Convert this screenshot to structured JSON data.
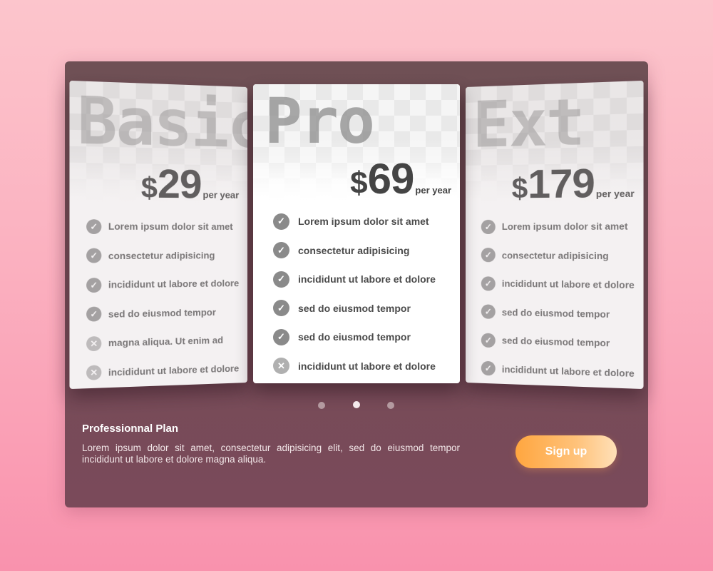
{
  "plans": [
    {
      "name": "Basic",
      "currency": "$",
      "amount": "29",
      "period": "per year",
      "features": [
        {
          "text": "Lorem ipsum dolor sit amet",
          "included": true
        },
        {
          "text": "consectetur adipisicing",
          "included": true
        },
        {
          "text": "incididunt ut labore et dolore",
          "included": true
        },
        {
          "text": "sed do eiusmod tempor",
          "included": true
        },
        {
          "text": "magna aliqua. Ut enim ad",
          "included": false
        },
        {
          "text": "incididunt ut labore et dolore",
          "included": false
        }
      ]
    },
    {
      "name": "Pro",
      "currency": "$",
      "amount": "69",
      "period": "per year",
      "features": [
        {
          "text": "Lorem ipsum dolor sit amet",
          "included": true
        },
        {
          "text": "consectetur adipisicing",
          "included": true
        },
        {
          "text": "incididunt ut labore et dolore",
          "included": true
        },
        {
          "text": "sed do eiusmod tempor",
          "included": true
        },
        {
          "text": "sed do eiusmod tempor",
          "included": true
        },
        {
          "text": "incididunt ut labore et dolore",
          "included": false
        }
      ]
    },
    {
      "name": "Ext",
      "currency": "$",
      "amount": "179",
      "period": "per year",
      "features": [
        {
          "text": "Lorem ipsum dolor sit amet",
          "included": true
        },
        {
          "text": "consectetur adipisicing",
          "included": true
        },
        {
          "text": "incididunt ut labore et dolore",
          "included": true
        },
        {
          "text": "sed do eiusmod tempor",
          "included": true
        },
        {
          "text": "sed do eiusmod tempor",
          "included": true
        },
        {
          "text": "incididunt ut labore et dolore",
          "included": true
        }
      ]
    }
  ],
  "carousel": {
    "count": 3,
    "active_index": 1
  },
  "details": {
    "title": "Professionnal Plan",
    "description": "Lorem ipsum dolor sit amet, consectetur adipisicing elit, sed do eiusmod tempor incididunt ut labore et dolore magna aliqua."
  },
  "cta": {
    "label": "Sign up"
  },
  "icons": {
    "included": "check-icon",
    "excluded": "cross-icon"
  },
  "colors": {
    "background": "#fbb1c0",
    "panel": "#744c56",
    "cta_start": "#ffa63f",
    "cta_end": "#ffe0b8"
  }
}
